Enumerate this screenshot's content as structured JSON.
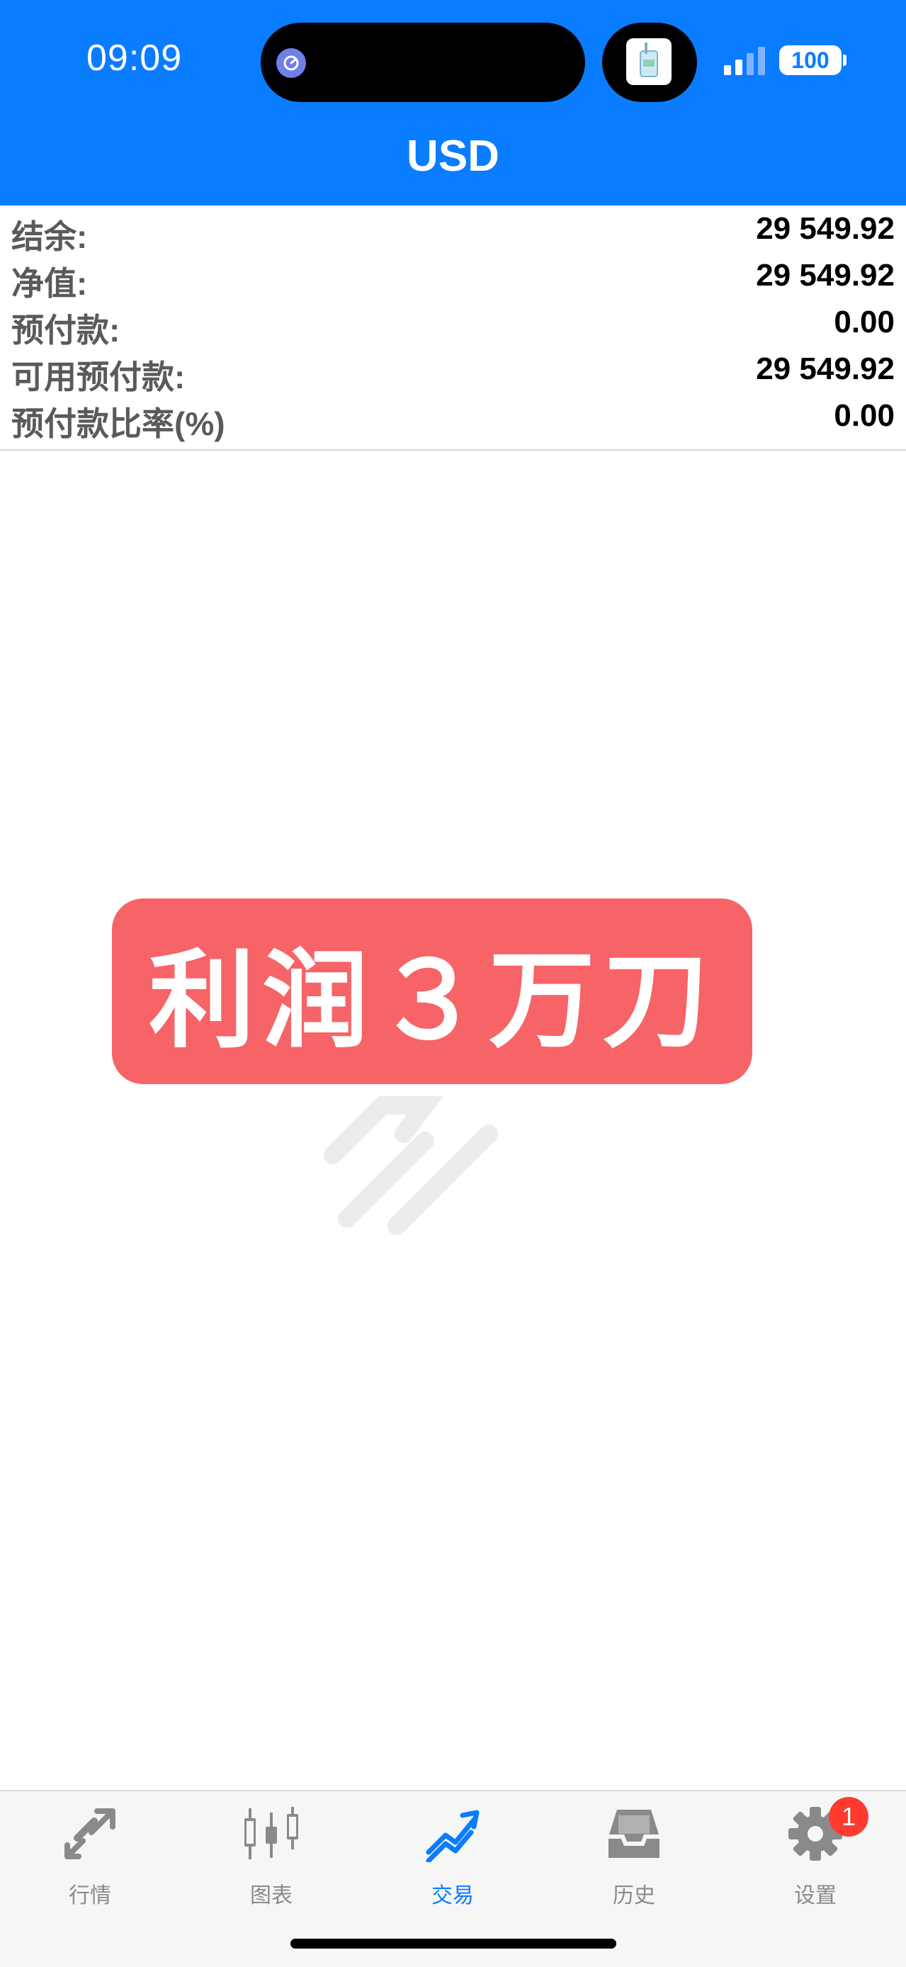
{
  "status_bar": {
    "time": "09:09",
    "battery": "100"
  },
  "header": {
    "title": "USD"
  },
  "account": {
    "rows": [
      {
        "label": "结余:",
        "value": "29 549.92"
      },
      {
        "label": "净值:",
        "value": "29 549.92"
      },
      {
        "label": "预付款:",
        "value": "0.00"
      },
      {
        "label": "可用预付款:",
        "value": "29 549.92"
      },
      {
        "label": "预付款比率(%)",
        "value": "0.00"
      }
    ]
  },
  "banner": {
    "text": "利润３万刀"
  },
  "tabbar": {
    "tabs": [
      {
        "label": "行情",
        "icon": "quotes-arrows-icon"
      },
      {
        "label": "图表",
        "icon": "candlestick-chart-icon"
      },
      {
        "label": "交易",
        "icon": "trade-trend-icon"
      },
      {
        "label": "历史",
        "icon": "history-inbox-icon"
      },
      {
        "label": "设置",
        "icon": "gear-icon"
      }
    ],
    "active": "交易",
    "settings_badge": "1"
  },
  "colors": {
    "header_bg": "#0a7cff",
    "banner_bg": "#f76467",
    "active_tab": "#0a7cff",
    "inactive_tab": "#8a8a8a",
    "badge": "#ff3b30"
  }
}
